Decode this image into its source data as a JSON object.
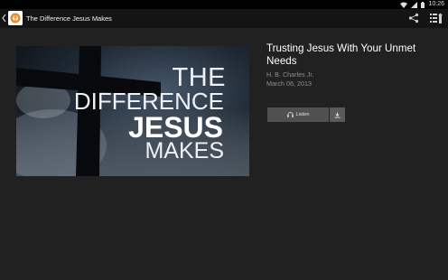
{
  "status_bar": {
    "time": "10:26"
  },
  "action_bar": {
    "title": "The Difference Jesus Makes"
  },
  "artwork": {
    "line1": "THE",
    "line2": "DIFFERENCE",
    "line3": "JESUS",
    "line4": "MAKES"
  },
  "sermon": {
    "title": "Trusting Jesus With Your Unmet Needs",
    "speaker": "H. B. Charles Jr.",
    "date": "March 06, 2013"
  },
  "actions": {
    "listen_label": "Listen"
  },
  "colors": {
    "background": "#212121",
    "action_bar": "#141414",
    "status_bar": "#000000",
    "button": "#505050",
    "secondary_text": "#8f8f8f",
    "logo_accent": "#e8892b"
  },
  "icons": [
    "wifi-icon",
    "signal-icon",
    "battery-icon",
    "back-chevron-icon",
    "share-icon",
    "queue-icon",
    "headphones-icon",
    "download-icon"
  ]
}
